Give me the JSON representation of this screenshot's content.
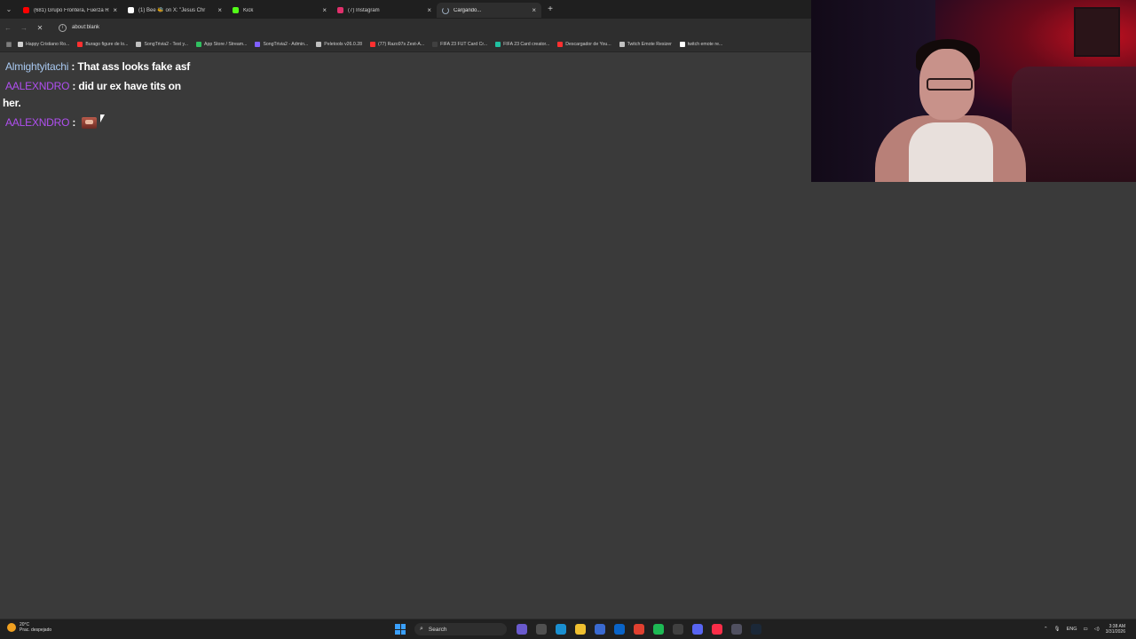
{
  "browser": {
    "tabs": [
      {
        "title": "(681) Grupo Frontera, Fuerza R",
        "icon": "youtube-icon",
        "color": "#ff0000",
        "active": false
      },
      {
        "title": "(1) Bee 🐝 on X: \"Jesus Chr",
        "icon": "x-icon",
        "color": "#ffffff",
        "active": false
      },
      {
        "title": "Kick",
        "icon": "kick-icon",
        "color": "#53fc18",
        "active": false
      },
      {
        "title": "(7) Instagram",
        "icon": "instagram-icon",
        "color": "#e1306c",
        "active": false
      },
      {
        "title": "Cargando...",
        "icon": "loading-spinner-icon",
        "color": "#99aabb",
        "active": true
      }
    ],
    "new_tab_label": "+",
    "address": "about:blank",
    "bookmarks": [
      {
        "label": "Happy Cristiano Ro...",
        "color": "#d0d0d0"
      },
      {
        "label": "Burago figure de lo...",
        "color": "#ff3030"
      },
      {
        "label": "SongTrivia2 - Test y...",
        "color": "#c0c0c0"
      },
      {
        "label": "App Store / Stream...",
        "color": "#30c060"
      },
      {
        "label": "SongTrivia2 - Admin...",
        "color": "#8060ff"
      },
      {
        "label": "Peletools v26.0.28",
        "color": "#c0c0c0"
      },
      {
        "label": "(77) Razo97s Zest-A...",
        "color": "#ff3030"
      },
      {
        "label": "FIFA 23 FUT Card Cr...",
        "color": "#404040"
      },
      {
        "label": "FIFA 23 Card creator...",
        "color": "#20c0a0"
      },
      {
        "label": "Descargador de You...",
        "color": "#ff3030"
      },
      {
        "label": "Twitch Emote Resizer",
        "color": "#c0c0c0"
      },
      {
        "label": "twitch emote re...",
        "color": "#ffffff"
      }
    ]
  },
  "chat": {
    "messages": [
      {
        "user": "Almightyitachi",
        "user_color": "#a8c8f0",
        "separator": " : ",
        "text": "That ass looks fake asf",
        "has_emote": false
      },
      {
        "user": "AALEXNDRO",
        "user_color": "#b04ff0",
        "separator": " : ",
        "text": "did ur ex have tits on her.",
        "has_emote": false
      },
      {
        "user": "AALEXNDRO",
        "user_color": "#b04ff0",
        "separator": " : ",
        "text": "",
        "has_emote": true,
        "emote": "emote-icon"
      }
    ]
  },
  "taskbar": {
    "weather_temp": "20°C",
    "weather_desc": "Prac. despejado",
    "search_label": "Search",
    "language": "ENG",
    "time": "3:38 AM",
    "date": "3/31/2026",
    "apps": [
      {
        "name": "copilot-icon",
        "color": "#6a5acd"
      },
      {
        "name": "task-view-icon",
        "color": "#505050"
      },
      {
        "name": "edge-icon",
        "color": "#1a8fd0"
      },
      {
        "name": "file-explorer-icon",
        "color": "#f0c030"
      },
      {
        "name": "store-icon",
        "color": "#3a6ad0"
      },
      {
        "name": "outlook-icon",
        "color": "#0a64c8"
      },
      {
        "name": "chrome-icon",
        "color": "#e04030"
      },
      {
        "name": "spotify-icon",
        "color": "#1db954"
      },
      {
        "name": "obs-icon",
        "color": "#404040"
      },
      {
        "name": "discord-icon",
        "color": "#5865f2"
      },
      {
        "name": "music-icon",
        "color": "#fa2d48"
      },
      {
        "name": "app-icon",
        "color": "#505060"
      },
      {
        "name": "steam-icon",
        "color": "#1b2838"
      }
    ]
  }
}
